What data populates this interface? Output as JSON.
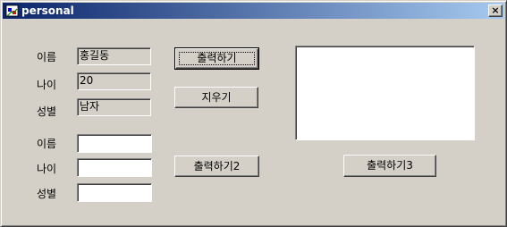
{
  "window": {
    "title": "personal",
    "close_label": "×"
  },
  "display": {
    "name_label": "이름",
    "name_value": "홍길동",
    "age_label": "나이",
    "age_value": "20",
    "gender_label": "성별",
    "gender_value": "남자"
  },
  "input": {
    "name_label": "이름",
    "name_value": "",
    "age_label": "나이",
    "age_value": "",
    "gender_label": "성별",
    "gender_value": ""
  },
  "buttons": {
    "print": "출력하기",
    "clear": "지우기",
    "print2": "출력하기2",
    "print3": "출력하기3"
  },
  "output_list": {
    "items": []
  },
  "colors": {
    "face": "#d4d0c8",
    "title_start": "#0a246a",
    "title_end": "#a6caf0"
  },
  "icons": {
    "window_icon": "app-icon",
    "close": "close-icon"
  }
}
